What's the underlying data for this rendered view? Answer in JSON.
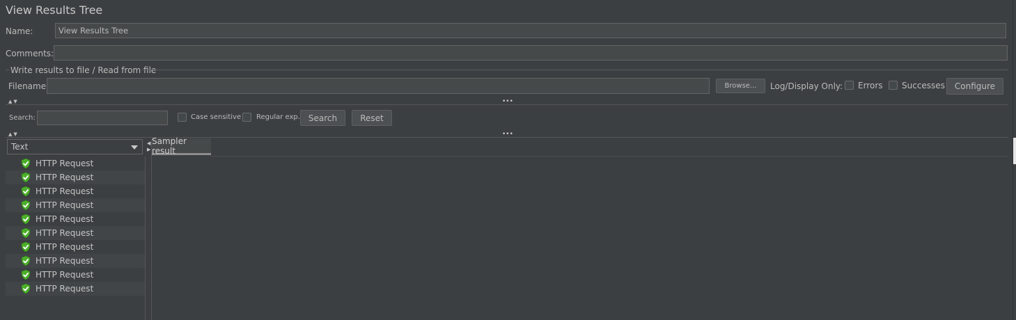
{
  "window": {
    "title": "View Results Tree"
  },
  "form": {
    "name_label": "Name:",
    "name_value": "View Results Tree",
    "comments_label": "Comments:",
    "comments_value": ""
  },
  "file_group": {
    "legend": "Write results to file / Read from file",
    "filename_label": "Filename",
    "filename_value": "",
    "browse_label": "Browse...",
    "log_display_label": "Log/Display Only:",
    "errors_label": "Errors",
    "successes_label": "Successes",
    "configure_label": "Configure",
    "errors_checked": false,
    "successes_checked": false
  },
  "search": {
    "label": "Search:",
    "value": "",
    "case_sensitive_label": "Case sensitive",
    "regex_label": "Regular exp.",
    "search_button": "Search",
    "reset_button": "Reset"
  },
  "results": {
    "renderer_selected": "Text",
    "tab_label": "Sampler result",
    "items": [
      {
        "label": "HTTP Request",
        "status": "success"
      },
      {
        "label": "HTTP Request",
        "status": "success"
      },
      {
        "label": "HTTP Request",
        "status": "success"
      },
      {
        "label": "HTTP Request",
        "status": "success"
      },
      {
        "label": "HTTP Request",
        "status": "success"
      },
      {
        "label": "HTTP Request",
        "status": "success"
      },
      {
        "label": "HTTP Request",
        "status": "success"
      },
      {
        "label": "HTTP Request",
        "status": "success"
      },
      {
        "label": "HTTP Request",
        "status": "success"
      },
      {
        "label": "HTTP Request",
        "status": "success"
      }
    ]
  },
  "icons": {
    "success": "green-shield-check-icon",
    "dropdown": "chevron-down-icon",
    "collapse": "triangle-up-down-icon",
    "divider_grip": "ellipsis-grip-icon"
  },
  "colors": {
    "background": "#3c3f41",
    "field": "#45494a",
    "success_green": "#4caf2a"
  }
}
